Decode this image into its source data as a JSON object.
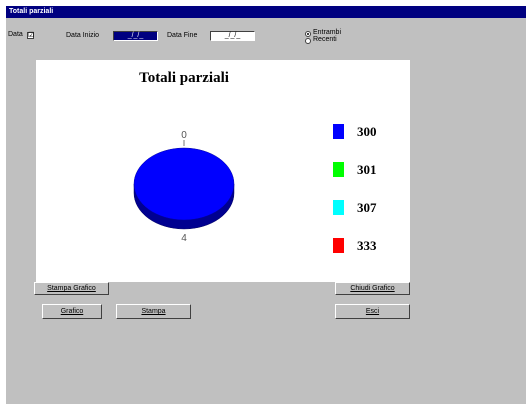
{
  "window": {
    "title": "Totali parziali"
  },
  "filters": {
    "data_label": "Data",
    "data_checked": "☑",
    "data_inizio_label": "Data Inizio",
    "data_inizio_value": "_/_/_",
    "data_fine_label": "Data Fine",
    "data_fine_value": "_/_/_",
    "radio_options": [
      "Entrambi",
      "Recenti"
    ]
  },
  "chart_data": {
    "type": "pie",
    "title": "Totali parziali",
    "top_label": "0",
    "bottom_label": "4",
    "legend": [
      {
        "label": "300",
        "color": "#0000ff"
      },
      {
        "label": "301",
        "color": "#00ff00"
      },
      {
        "label": "307",
        "color": "#00ffff"
      },
      {
        "label": "333",
        "color": "#ff0000"
      }
    ],
    "slices": [
      {
        "label": "300",
        "share": 1.0,
        "color": "#0000ff"
      }
    ]
  },
  "buttons": {
    "stampa_grafico": "Stampa Grafico",
    "chiudi_grafico": "Chiudi Grafico",
    "grafico": "Grafico",
    "stampa": "Stampa",
    "esci": "Esci"
  }
}
